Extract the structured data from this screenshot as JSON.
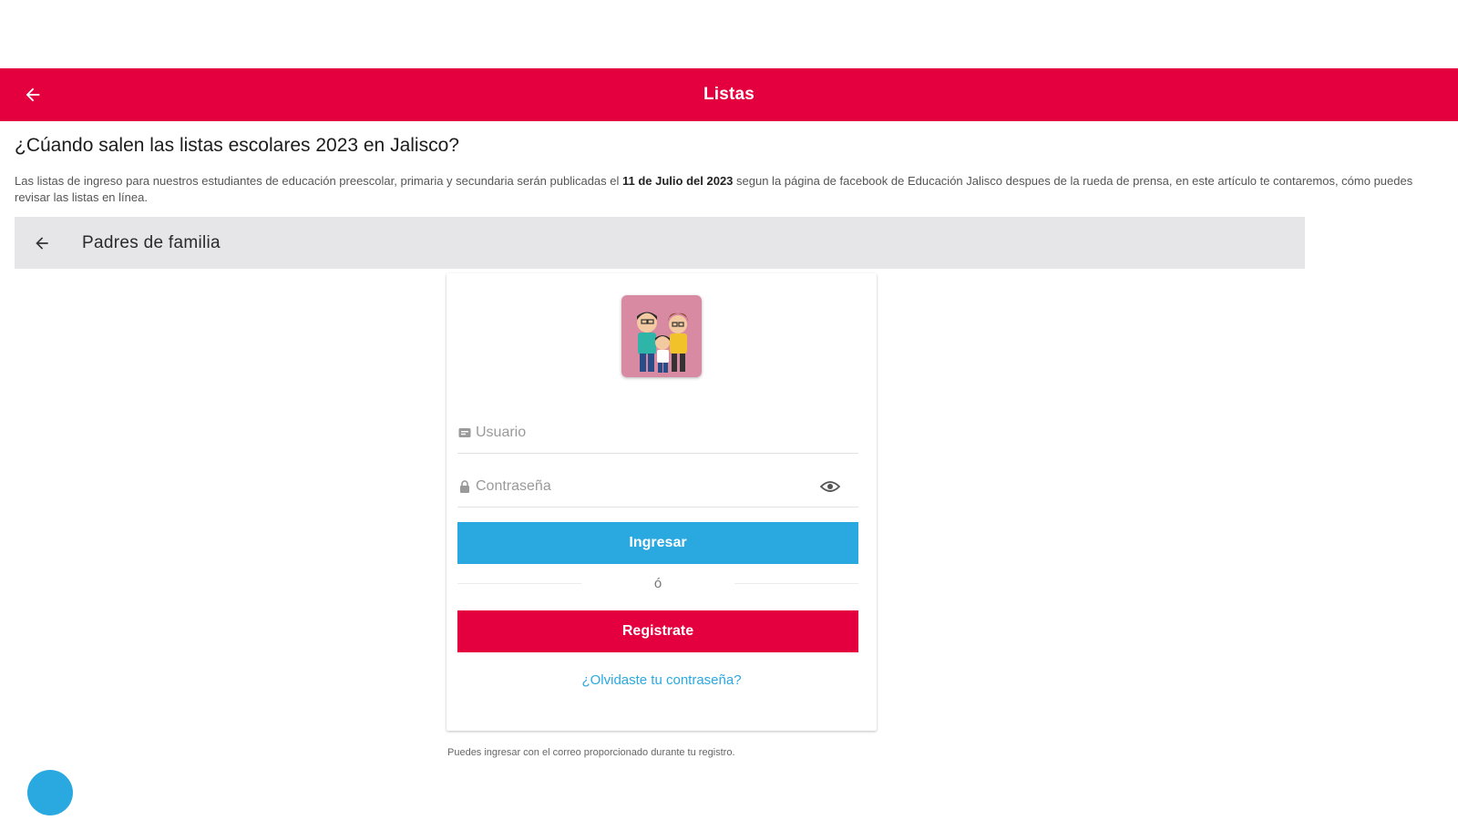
{
  "appbar": {
    "title": "Listas",
    "back_icon": "arrow-left-icon"
  },
  "article": {
    "headline": "¿Cúando salen las listas escolares 2023 en Jalisco?",
    "intro_before": "Las listas de ingreso para nuestros estudiantes de educación preescolar, primaria y secundaria serán publicadas el ",
    "intro_bold": "11 de Julio del 2023",
    "intro_after": " segun la página de facebook de Educación Jalisco despues de la rueda de prensa, en este artículo te contaremos, cómo puedes revisar las listas en línea."
  },
  "section": {
    "title": "Padres de familia",
    "back_icon": "arrow-left-icon"
  },
  "login": {
    "avatar": "family-avatar",
    "user_placeholder": "Usuario",
    "password_placeholder": "Contraseña",
    "login_label": "Ingresar",
    "or_label": "ó",
    "register_label": "Registrate",
    "forgot_label": "¿Olvidaste tu contraseña?"
  },
  "footer_note": "Puedes ingresar con el correo proporcionado durante tu registro.",
  "colors": {
    "primary": "#e4003f",
    "accent": "#2aa8e0",
    "section_bg": "#e6e6e8"
  }
}
